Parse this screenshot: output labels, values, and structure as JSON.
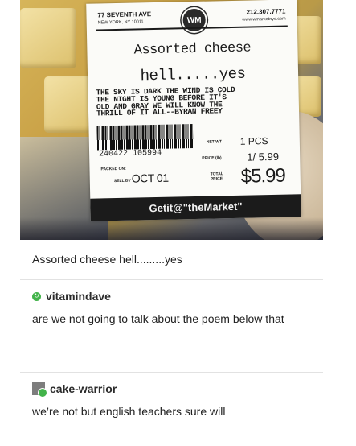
{
  "label": {
    "store_address": "77 SEVENTH AVE",
    "store_city": "NEW YORK, NY 10011",
    "phone": "212.307.7771",
    "website": "www.wmarketnyc.com",
    "logo_text": "WM",
    "product_line1": "Assorted cheese",
    "product_line2": "hell.....yes",
    "poem": "THE SKY IS DARK THE WIND IS COLD\nTHE NIGHT IS YOUNG BEFORE IT'S\nOLD AND GRAY WE WILL KNOW THE\nTHRILL OF IT ALL--BYRAN FREEY",
    "barcode_number": "240422 105994",
    "net_wt_label": "NET WT",
    "qty": "1 PCS",
    "price_label": "PRICE (lb)",
    "unit_price": "1/ 5.99",
    "packed_on_label": "PACKED ON:",
    "sell_by_label": "SELL BY",
    "sell_by_date": "OCT 01",
    "total_label": "TOTAL\nPRICE",
    "total_price": "$5.99",
    "footer_slogan": "Getit@\"theMarket\""
  },
  "caption": "Assorted cheese hell.........yes",
  "posts": [
    {
      "username": "vitamindave",
      "text": "are we not going to talk about the poem below that"
    },
    {
      "username": "cake-warrior",
      "text": "we’re not but english teachers sure will"
    }
  ],
  "colors": {
    "reblog_green": "#42b34a",
    "label_dark": "#1b1b1b"
  }
}
